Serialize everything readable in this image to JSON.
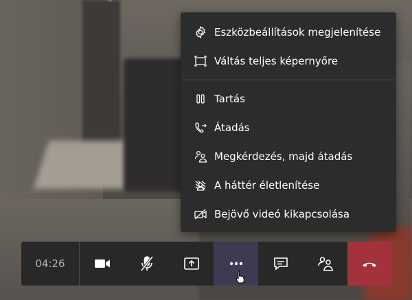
{
  "menu": {
    "items": [
      {
        "label": "Eszközbeállítások megjelenítése",
        "icon": "gear-icon"
      },
      {
        "label": "Váltás teljes képernyőre",
        "icon": "fullscreen-icon"
      },
      {
        "label": "Tartás",
        "icon": "pause-icon"
      },
      {
        "label": "Átadás",
        "icon": "transfer-icon"
      },
      {
        "label": "Megkérdezés, majd átadás",
        "icon": "consult-transfer-icon"
      },
      {
        "label": "A háttér életlenítése",
        "icon": "blur-background-icon"
      },
      {
        "label": "Bejövő videó kikapcsolása",
        "icon": "video-off-icon"
      }
    ]
  },
  "toolbar": {
    "timer": "04:26",
    "buttons": [
      "camera-icon",
      "mic-muted-icon",
      "share-screen-icon",
      "more-icon",
      "chat-icon",
      "participants-icon",
      "hang-up-icon"
    ]
  },
  "colors": {
    "menu_bg": "#2d2c2c",
    "toolbar_bg": "#292828",
    "active_bg": "#3c3b52",
    "hangup_bg": "#a4323d"
  }
}
